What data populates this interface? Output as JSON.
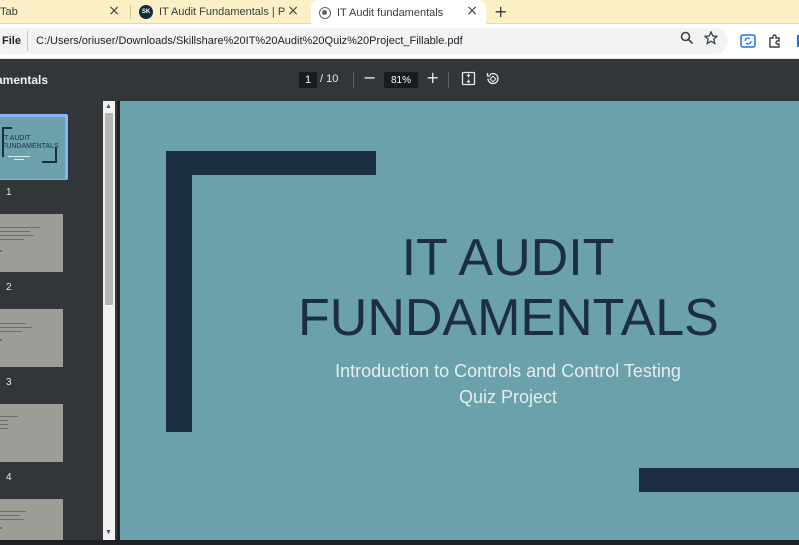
{
  "tabs": [
    {
      "title": "Tab",
      "close": "×"
    },
    {
      "title": "IT Audit Fundamentals | Peju Ak",
      "favicon": "SK",
      "close": "×"
    },
    {
      "title": "IT Audit fundamentals",
      "close": "×",
      "active": true
    }
  ],
  "new_tab_label": "+",
  "address_bar": {
    "chip": "File",
    "url": "C:/Users/oriuser/Downloads/Skillshare%20IT%20Audit%20Quiz%20Project_Fillable.pdf"
  },
  "pdf_toolbar": {
    "doc_title": "amentals",
    "current_page": "1",
    "page_total": "/ 10",
    "zoom_out": "−",
    "zoom_level": "81%",
    "zoom_in": "+"
  },
  "thumbnails": [
    {
      "number": "1",
      "title": "IT AUDIT FUNDAMENTALS"
    },
    {
      "number": "2"
    },
    {
      "number": "3"
    },
    {
      "number": "4"
    }
  ],
  "slide": {
    "title_line1": "IT AUDIT",
    "title_line2": "FUNDAMENTALS",
    "subtitle_line1": "Introduction to Controls and Control Testing",
    "subtitle_line2": "Quiz Project"
  },
  "colors": {
    "slide_background": "#6aa1aa",
    "slide_navy": "#1c2f42",
    "tabstrip": "#fbf0c6",
    "viewer_toolbar": "#323639"
  },
  "icons": [
    "search-icon",
    "star-icon",
    "sync-icon",
    "extensions-icon",
    "fit-page-icon",
    "rotate-icon"
  ]
}
